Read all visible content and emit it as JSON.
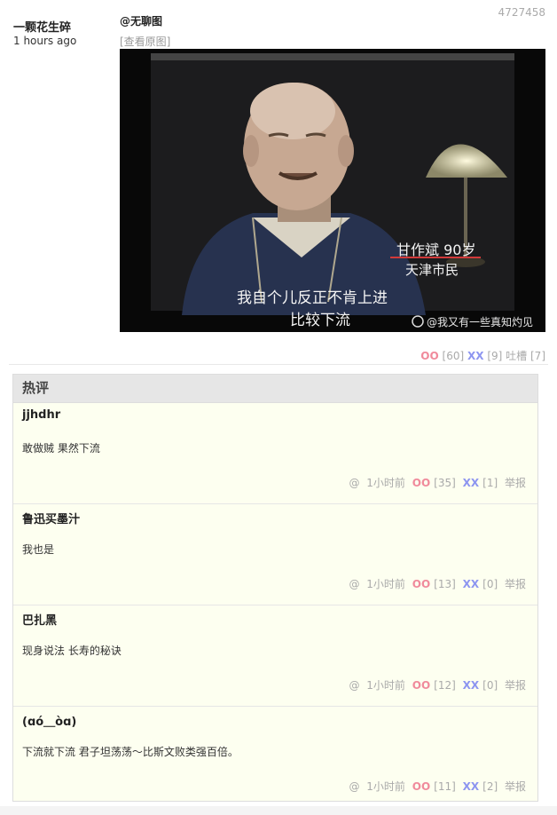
{
  "post": {
    "author": "一颗花生碎",
    "time": "1 hours ago",
    "id": "4727458",
    "tag": "@无聊图",
    "view_original": "[查看原图]",
    "photo": {
      "caption_line1": "我自个儿反正不肯上进",
      "caption_line2": "比较下流",
      "name_tag": "甘作斌  90岁",
      "location_tag": "天津市民",
      "watermark": "@我又有一些真知灼见"
    },
    "votes": {
      "oo_label": "OO",
      "oo_count": "[60]",
      "xx_label": "XX",
      "xx_count": "[9]",
      "tucao_label": "吐槽",
      "tucao_count": "[7]"
    }
  },
  "hot_comments": {
    "title": "热评",
    "items": [
      {
        "author": "jjhdhr",
        "text": "敢做贼 果然下流",
        "at": "@",
        "time": "1小时前",
        "oo": "OO",
        "oo_count": "[35]",
        "xx": "XX",
        "xx_count": "[1]",
        "report": "举报"
      },
      {
        "author": "鲁迅买墨汁",
        "text": "我也是",
        "at": "@",
        "time": "1小时前",
        "oo": "OO",
        "oo_count": "[13]",
        "xx": "XX",
        "xx_count": "[0]",
        "report": "举报"
      },
      {
        "author": "巴扎黑",
        "text": "现身说法 长寿的秘诀",
        "at": "@",
        "time": "1小时前",
        "oo": "OO",
        "oo_count": "[12]",
        "xx": "XX",
        "xx_count": "[0]",
        "report": "举报"
      },
      {
        "author": "(ɑó＿òɑ)",
        "text": "下流就下流 君子坦荡荡～比斯文败类强百倍。",
        "at": "@",
        "time": "1小时前",
        "oo": "OO",
        "oo_count": "[11]",
        "xx": "XX",
        "xx_count": "[2]",
        "report": "举报"
      }
    ]
  }
}
